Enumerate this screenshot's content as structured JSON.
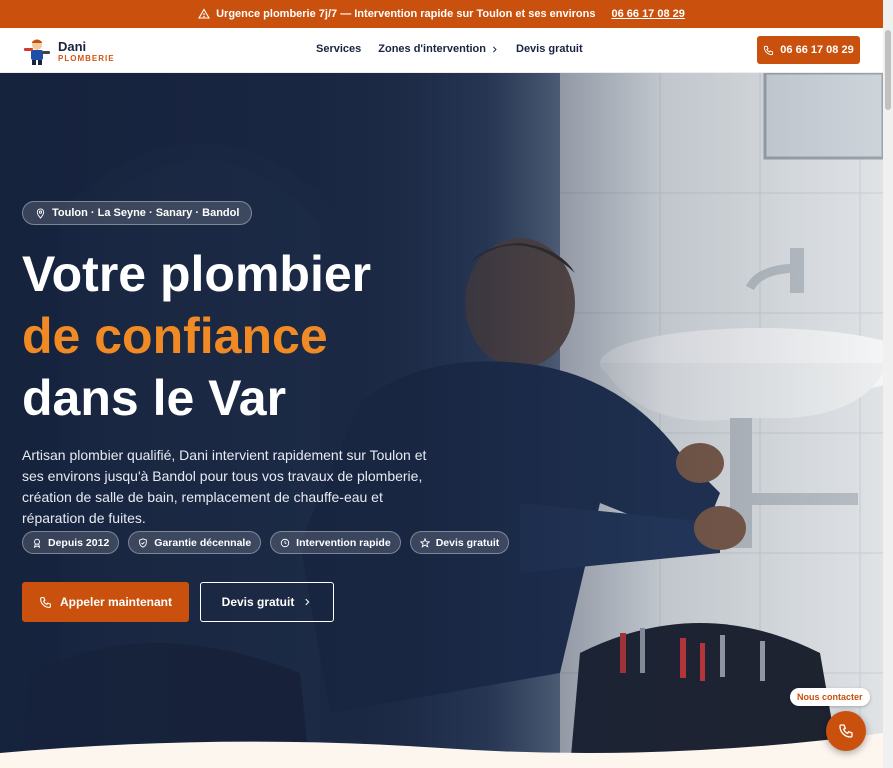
{
  "topbar": {
    "message": "Urgence plomberie 7j/7 — Intervention rapide sur Toulon et ses environs",
    "phone": "06 66 17 08 29"
  },
  "header": {
    "logo_name": "Dani",
    "logo_sub": "PLOMBERIE",
    "nav": [
      {
        "label": "Services"
      },
      {
        "label": "Zones d'intervention"
      },
      {
        "label": "Devis gratuit"
      }
    ],
    "call_button": "06 66 17 08 29"
  },
  "hero": {
    "location": "Toulon · La Seyne · Sanary · Bandol",
    "title_line1": "Votre plombier",
    "title_accent": "de confiance",
    "title_line3": "dans le Var",
    "lead": "Artisan plombier qualifié, Dani intervient rapidement sur Toulon et ses environs jusqu'à Bandol pour tous vos travaux de plomberie, création de salle de bain, remplacement de chauffe-eau et réparation de fuites.",
    "badges": [
      {
        "label": "Depuis 2012",
        "icon": "award-icon"
      },
      {
        "label": "Garantie décennale",
        "icon": "shield-icon"
      },
      {
        "label": "Intervention rapide",
        "icon": "clock-icon"
      },
      {
        "label": "Devis gratuit",
        "icon": "star-icon"
      }
    ],
    "cta_primary": "Appeler maintenant",
    "cta_secondary": "Devis gratuit"
  },
  "floating": {
    "contact_label": "Nous contacter"
  },
  "colors": {
    "brand": "#c9500d",
    "accent": "#f08a24",
    "navy": "#1a2440"
  }
}
